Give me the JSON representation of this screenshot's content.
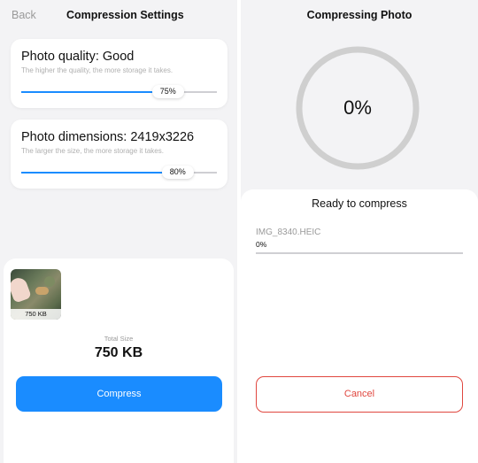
{
  "left": {
    "back_label": "Back",
    "title": "Compression Settings",
    "quality": {
      "title": "Photo quality: Good",
      "subtitle": "The higher the quality, the more storage it takes.",
      "value_label": "75%",
      "value": 0.75
    },
    "dimensions": {
      "title": "Photo dimensions: 2419x3226",
      "subtitle": "The larger the size, the more storage it takes.",
      "value_label": "80%",
      "value": 0.8
    },
    "photo": {
      "size_label": "750 KB"
    },
    "total_label": "Total Size",
    "total_value": "750 KB",
    "compress_label": "Compress"
  },
  "right": {
    "title": "Compressing Photo",
    "progress_label": "0%",
    "progress": 0,
    "status_title": "Ready to compress",
    "file_name": "IMG_8340.HEIC",
    "file_progress_label": "0%",
    "file_progress": 0,
    "cancel_label": "Cancel"
  },
  "colors": {
    "accent": "#1a8cff",
    "danger": "#e0473f",
    "ring": "#cfcfcf",
    "background": "#f3f3f5"
  }
}
